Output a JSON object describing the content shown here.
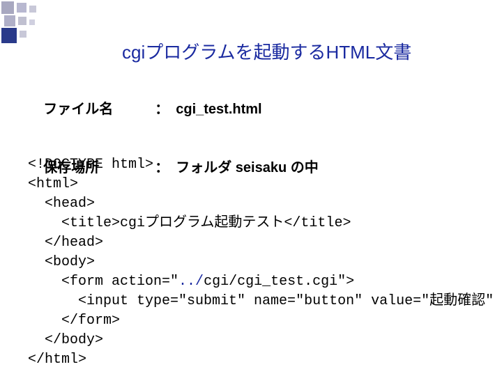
{
  "title": "cgiプログラムを起動するHTML文書",
  "meta": {
    "filename_label": "ファイル名",
    "filename_value": "cgi_test.html",
    "location_label": "保存場所",
    "location_value": "フォルダ seisaku の中",
    "colon": "："
  },
  "code": {
    "l1": "<!DOCTYPE html>",
    "l2": "<html>",
    "l3": "  <head>",
    "l4": "    <title>cgiプログラム起動テスト</title>",
    "l5": "  </head>",
    "l6": "  <body>",
    "l7a": "    <form action=\"",
    "l7b": "../",
    "l7c": "cgi/cgi_test.cgi\">",
    "l8": "      <input type=\"submit\" name=\"button\" value=\"起動確認\" />",
    "l9": "    </form>",
    "l10": "  </body>",
    "l11": "</html>"
  }
}
